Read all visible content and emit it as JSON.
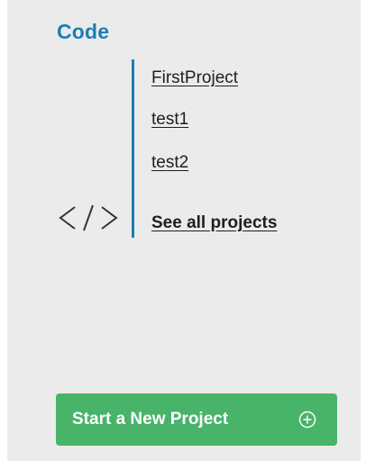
{
  "section": {
    "title": "Code",
    "accent_color": "#1a7fb5"
  },
  "projects": [
    {
      "label": "FirstProject"
    },
    {
      "label": "test1"
    },
    {
      "label": "test2"
    }
  ],
  "see_all_label": "See all projects",
  "icons": {
    "code": "code-brackets-icon",
    "plus": "plus-circle-icon"
  },
  "start_button": {
    "label": "Start a New Project",
    "color": "#48b46a"
  }
}
